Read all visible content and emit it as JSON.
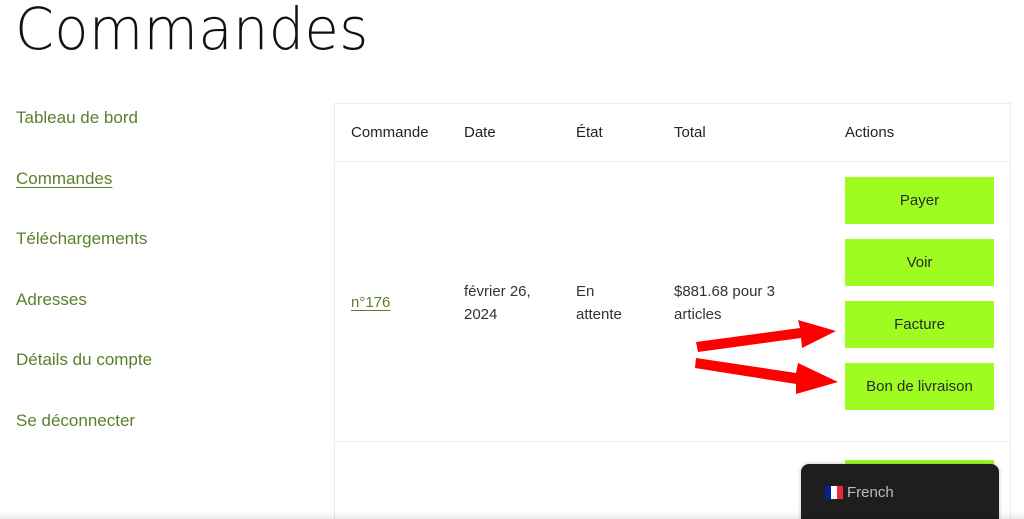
{
  "page": {
    "title": "Commandes"
  },
  "sidebar": {
    "items": [
      {
        "label": "Tableau de bord",
        "active": false
      },
      {
        "label": "Commandes",
        "active": true
      },
      {
        "label": "Téléchargements",
        "active": false
      },
      {
        "label": "Adresses",
        "active": false
      },
      {
        "label": "Détails du compte",
        "active": false
      },
      {
        "label": "Se déconnecter",
        "active": false
      }
    ]
  },
  "table": {
    "headers": [
      "Commande",
      "Date",
      "État",
      "Total",
      "Actions"
    ],
    "rows": [
      {
        "order": "n°176",
        "date_line1": "février 26,",
        "date_line2": "2024",
        "status_line1": "En",
        "status_line2": "attente",
        "total_line1": "$881.68 pour 3",
        "total_line2": "articles",
        "actions": [
          "Payer",
          "Voir",
          "Facture",
          "Bon de livraison"
        ]
      }
    ]
  },
  "annotations": {
    "arrow_color": "#ff0000",
    "targets": [
      "Facture",
      "Bon de livraison"
    ]
  },
  "colors": {
    "accent_green": "#9ffc21",
    "link_green": "#5b7f2a",
    "lang_bg": "#1e1e1e"
  },
  "language_switcher": {
    "label": "French",
    "flag_icon": "france-flag-icon"
  }
}
